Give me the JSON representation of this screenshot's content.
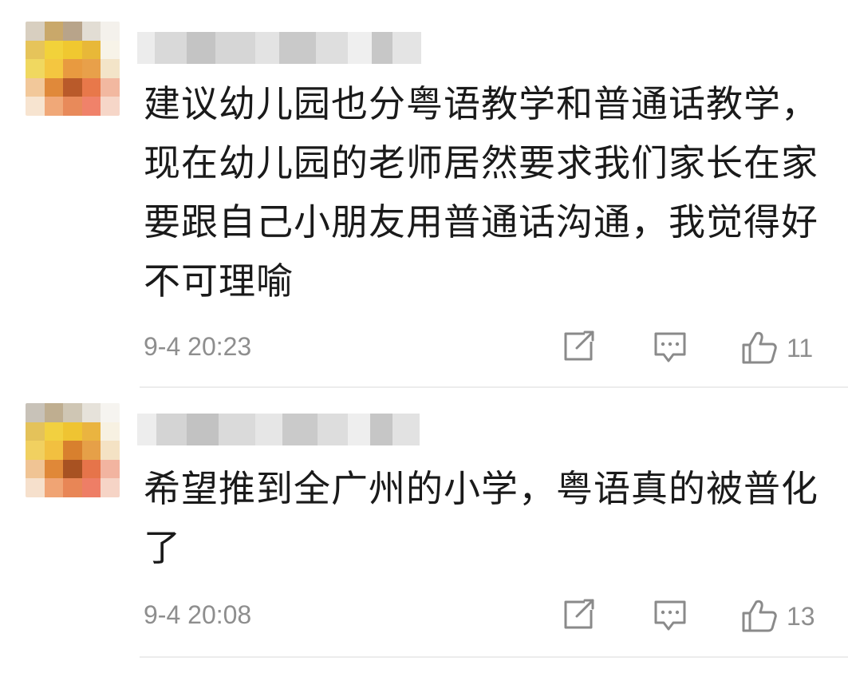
{
  "comments": [
    {
      "text": "建议幼儿园也分粤语教学和普通话教学，现在幼儿园的老师居然要求我们家长在家要跟自己小朋友用普通话沟通，我觉得好不可理喻",
      "timestamp": "9-4 20:23",
      "like_count": "11",
      "icons": {
        "share": "share-icon",
        "reply": "comment-icon",
        "like": "thumbs-up-icon"
      }
    },
    {
      "text": "希望推到全广州的小学，粤语真的被普化了",
      "timestamp": "9-4 20:08",
      "like_count": "13",
      "icons": {
        "share": "share-icon",
        "reply": "comment-icon",
        "like": "thumbs-up-icon"
      }
    }
  ],
  "colors": {
    "text": "#1a1a1a",
    "meta": "#8e8e8e",
    "icon": "#8a8a8a",
    "divider": "#ececec"
  }
}
